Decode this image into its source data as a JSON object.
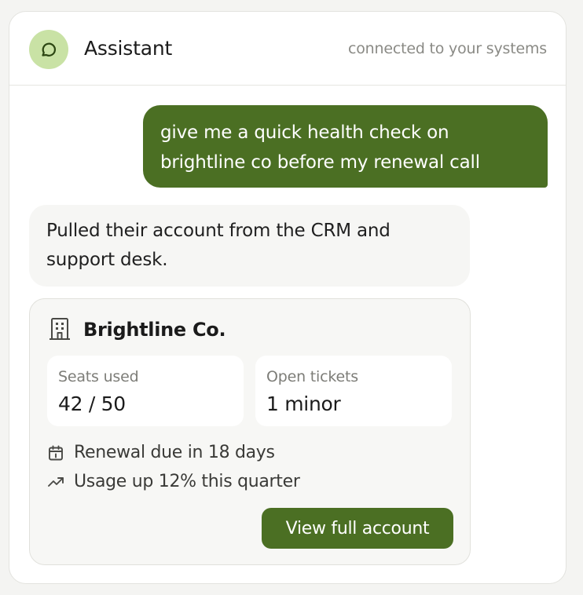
{
  "header": {
    "title": "Assistant",
    "status": "connected to your systems",
    "avatar_icon": "chat-bubble-icon",
    "avatar_color": "#c9e2a5"
  },
  "messages": {
    "user": {
      "lines": [
        "give me a quick health check on",
        "brightline co before my renewal call"
      ]
    },
    "assistant": {
      "lines": [
        "Pulled their account from the CRM and",
        "support desk."
      ]
    }
  },
  "account_card": {
    "company_icon": "building-icon",
    "company_name": "Brightline Co.",
    "stats": [
      {
        "label": "Seats used",
        "value": "42 / 50"
      },
      {
        "label": "Open tickets",
        "value": "1 minor"
      }
    ],
    "details": [
      {
        "icon": "calendar-icon",
        "text": "Renewal due in 18 days"
      },
      {
        "icon": "trending-up-icon",
        "text": "Usage up 12% this quarter"
      }
    ],
    "action_label": "View full account"
  },
  "colors": {
    "accent": "#4b6f23",
    "accent_light": "#c9e2a5"
  }
}
